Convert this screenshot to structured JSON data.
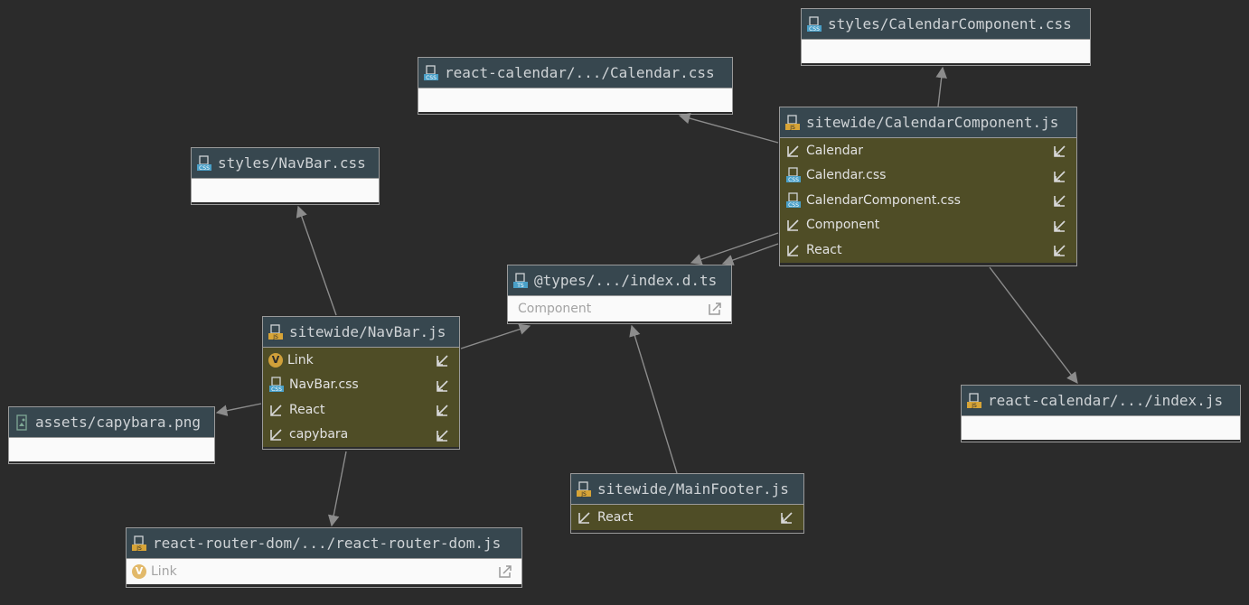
{
  "colors": {
    "background": "#2b2b2b",
    "header": "#37474f",
    "js_body": "#4f4d26",
    "plain_body": "#fafafa",
    "edge": "#8c8c8c",
    "css_badge": "#4aa0c8",
    "js_badge": "#d7a437",
    "ts_badge": "#4aa0c8"
  },
  "nodes": [
    {
      "id": "calendar-component-css",
      "title": "styles/CalendarComponent.css",
      "icon": "css-file-icon",
      "rows": []
    },
    {
      "id": "react-calendar-css",
      "title": "react-calendar/.../Calendar.css",
      "icon": "css-file-icon",
      "rows": []
    },
    {
      "id": "calendar-component-js",
      "title": "sitewide/CalendarComponent.js",
      "icon": "js-file-icon",
      "rows": [
        {
          "label": "Calendar",
          "icon": "import-arrow-icon"
        },
        {
          "label": "Calendar.css",
          "icon": "css-file-icon"
        },
        {
          "label": "CalendarComponent.css",
          "icon": "css-file-icon"
        },
        {
          "label": "Component",
          "icon": "import-arrow-icon"
        },
        {
          "label": "React",
          "icon": "import-arrow-icon"
        }
      ]
    },
    {
      "id": "navbar-css",
      "title": "styles/NavBar.css",
      "icon": "css-file-icon",
      "rows": []
    },
    {
      "id": "types-index",
      "title": "@types/.../index.d.ts",
      "icon": "ts-file-icon",
      "rows": [
        {
          "label": "Component",
          "icon": "none"
        }
      ]
    },
    {
      "id": "navbar-js",
      "title": "sitewide/NavBar.js",
      "icon": "js-file-icon",
      "rows": [
        {
          "label": "Link",
          "icon": "variable-icon"
        },
        {
          "label": "NavBar.css",
          "icon": "css-file-icon"
        },
        {
          "label": "React",
          "icon": "import-arrow-icon"
        },
        {
          "label": "capybara",
          "icon": "import-arrow-icon"
        }
      ]
    },
    {
      "id": "react-calendar-index",
      "title": "react-calendar/.../index.js",
      "icon": "js-file-icon",
      "rows": []
    },
    {
      "id": "capybara-png",
      "title": "assets/capybara.png",
      "icon": "image-file-icon",
      "rows": []
    },
    {
      "id": "main-footer-js",
      "title": "sitewide/MainFooter.js",
      "icon": "js-file-icon",
      "rows": [
        {
          "label": "React",
          "icon": "import-arrow-icon"
        }
      ]
    },
    {
      "id": "react-router-dom",
      "title": "react-router-dom/.../react-router-dom.js",
      "icon": "js-file-icon",
      "rows": [
        {
          "label": "Link",
          "icon": "variable-icon"
        }
      ]
    }
  ]
}
